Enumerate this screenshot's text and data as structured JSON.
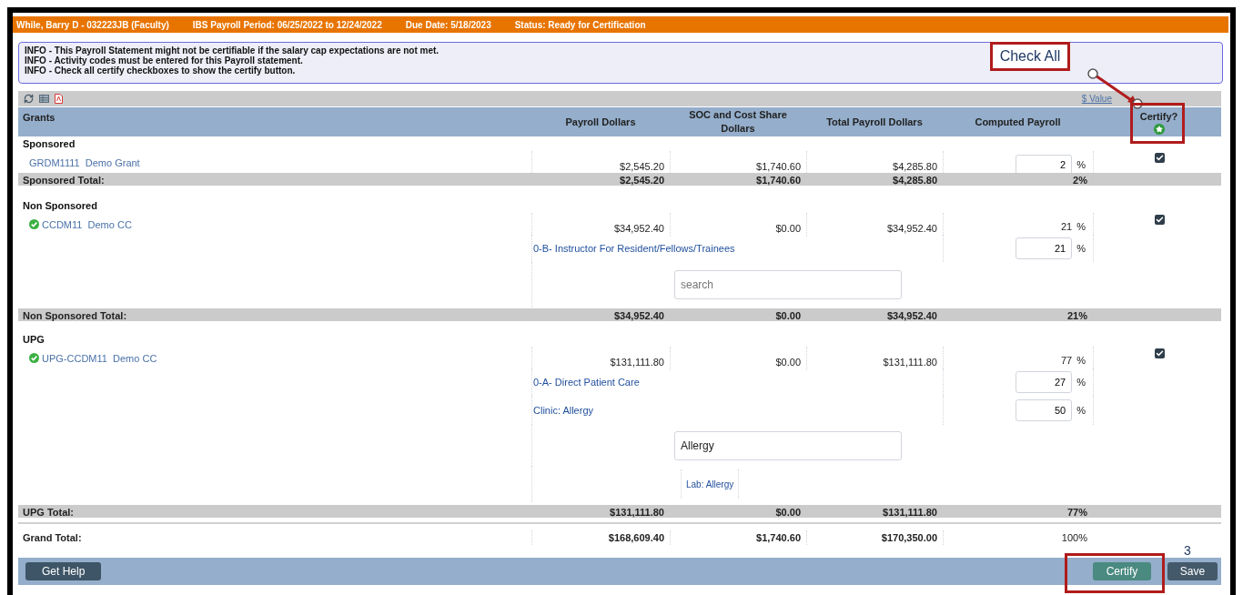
{
  "header": {
    "employee": "While, Barry D - 032223JB (Faculty)",
    "period": "IBS Payroll Period: 06/25/2022 to 12/24/2022",
    "due": "Due Date: 5/18/2023",
    "status": "Status: Ready for Certification"
  },
  "info": [
    "INFO - This Payroll Statement might not be certifiable if the salary cap expectations are not met.",
    "INFO - Activity codes must be entered for this Payroll statement.",
    "INFO - Check all certify checkboxes to show the certify button."
  ],
  "toolbar": {
    "value_link": "$ Value"
  },
  "columns": [
    "Grants",
    "Payroll Dollars",
    "SOC and Cost Share Dollars",
    "Total Payroll Dollars",
    "Computed Payroll",
    "Certify?"
  ],
  "groups": [
    {
      "name": "Sponsored",
      "items": [
        {
          "code": "GRDM1111",
          "name": "Demo Grant",
          "verified": false,
          "payroll": "$2,545.20",
          "soc": "$1,740.60",
          "total": "$4,285.80",
          "computed": "2",
          "kind": "input",
          "unit": "%",
          "certified": true
        }
      ],
      "total": {
        "label": "Sponsored Total:",
        "payroll": "$2,545.20",
        "soc": "$1,740.60",
        "total": "$4,285.80",
        "computed": "2%"
      }
    },
    {
      "name": "Non Sponsored",
      "items": [
        {
          "code": "CCDM11",
          "name": "Demo CC",
          "verified": true,
          "payroll": "$34,952.40",
          "soc": "$0.00",
          "total": "$34,952.40",
          "computed": "21",
          "kind": "text",
          "unit": "%",
          "certified": true,
          "activities": [
            {
              "label": "0-B- Instructor For Resident/Fellows/Trainees",
              "value": "21",
              "unit": "%"
            }
          ],
          "search": {
            "placeholder": "search"
          }
        }
      ],
      "total": {
        "label": "Non Sponsored Total:",
        "payroll": "$34,952.40",
        "soc": "$0.00",
        "total": "$34,952.40",
        "computed": "21%"
      }
    },
    {
      "name": "UPG",
      "items": [
        {
          "code": "UPG-CCDM11",
          "name": "Demo CC",
          "verified": true,
          "payroll": "$131,111.80",
          "soc": "$0.00",
          "total": "$131,111.80",
          "computed": "77",
          "kind": "text",
          "unit": "%",
          "certified": true,
          "activities": [
            {
              "label": "0-A- Direct Patient Care",
              "value": "27",
              "unit": "%"
            },
            {
              "label": "Clinic: Allergy",
              "value": "50",
              "unit": "%"
            }
          ],
          "search": {
            "value": "Allergy"
          },
          "options": [
            "Lab: Allergy"
          ]
        }
      ],
      "total": {
        "label": "UPG Total:",
        "payroll": "$131,111.80",
        "soc": "$0.00",
        "total": "$131,111.80",
        "computed": "77%"
      }
    }
  ],
  "grand_total": {
    "label": "Grand Total:",
    "payroll": "$168,609.40",
    "soc": "$1,740.60",
    "total": "$170,350.00",
    "computed": "100%"
  },
  "buttons": {
    "help": "Get Help",
    "certify": "Certify",
    "save": "Save"
  },
  "annotations": {
    "callout": "Check All",
    "step": "3"
  }
}
